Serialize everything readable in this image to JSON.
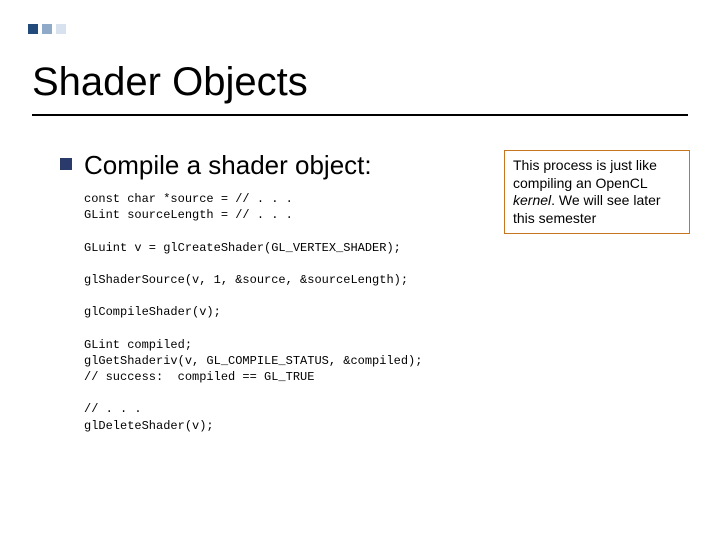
{
  "title": "Shader Objects",
  "bullet": "Compile a shader object:",
  "code": "const char *source = // . . .\nGLint sourceLength = // . . .\n\nGLuint v = glCreateShader(GL_VERTEX_SHADER);\n\nglShaderSource(v, 1, &source, &sourceLength);\n\nglCompileShader(v);\n\nGLint compiled;\nglGetShaderiv(v, GL_COMPILE_STATUS, &compiled);\n// success:  compiled == GL_TRUE\n\n// . . .\nglDeleteShader(v);",
  "note_prefix": "This process is just like compiling an OpenCL ",
  "note_em": "kernel",
  "note_suffix": ".  We will see later this semester"
}
